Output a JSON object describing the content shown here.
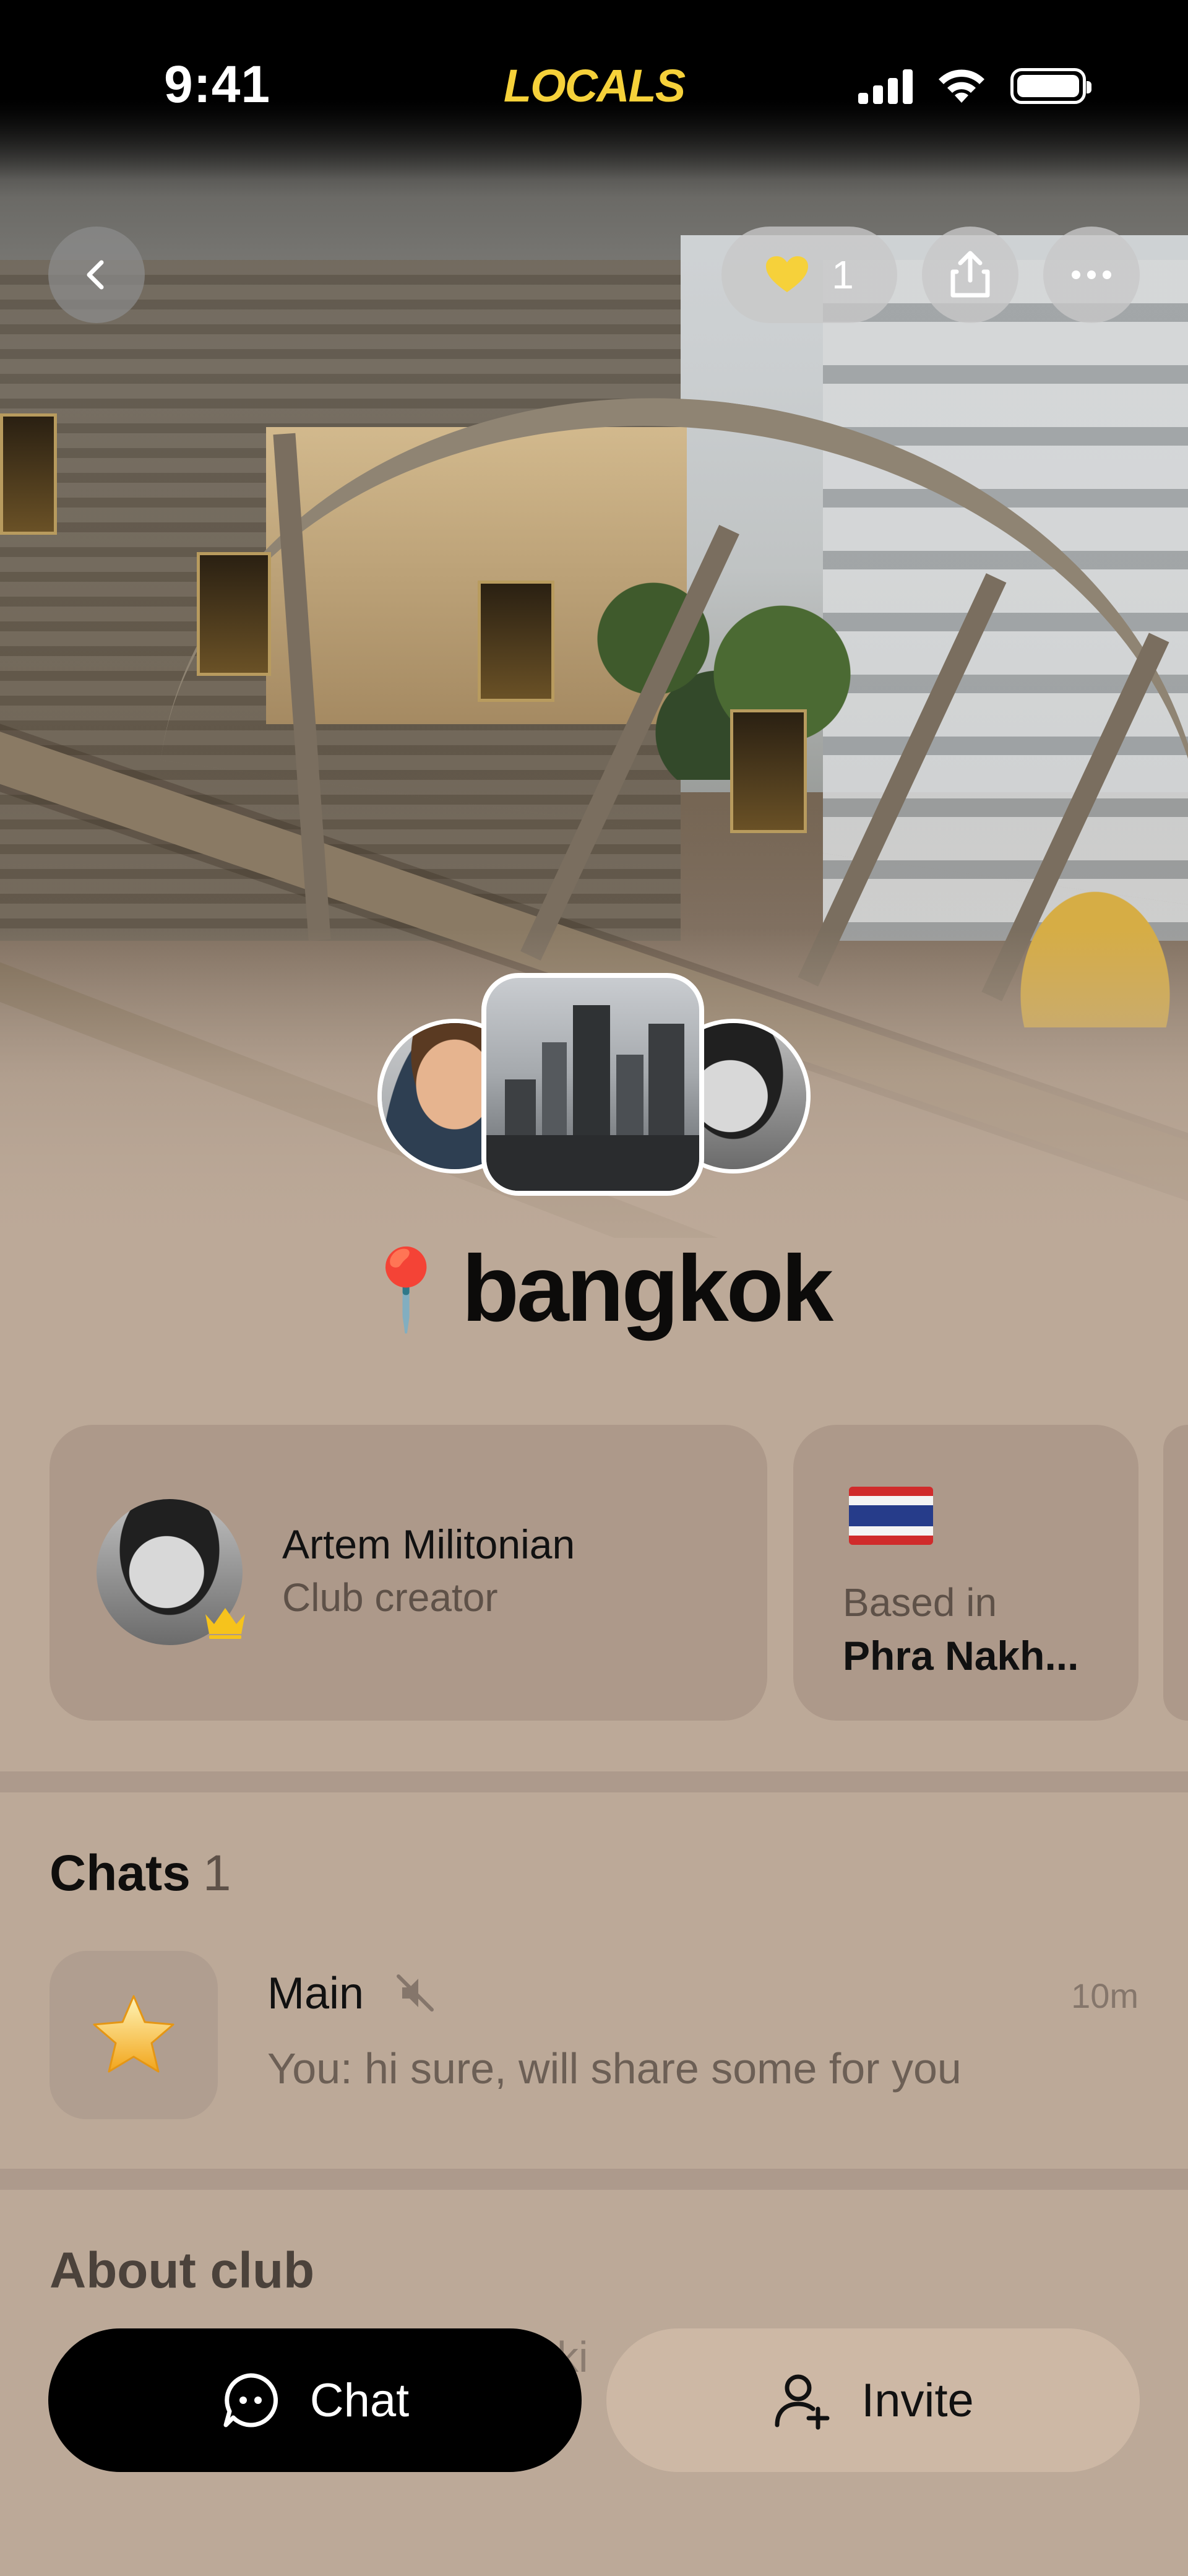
{
  "status_bar": {
    "time": "9:41",
    "brand": "LOCALS",
    "icons": [
      "signal-icon",
      "wifi-icon",
      "battery-icon"
    ]
  },
  "top_controls": {
    "back_icon": "chevron-left-icon",
    "likes": {
      "icon": "heart-icon",
      "count": "1",
      "color": "#f6d13a"
    },
    "share_icon": "share-icon",
    "more_icon": "more-icon"
  },
  "club": {
    "title": "bangkok",
    "pin_emoji": "📍"
  },
  "cards": {
    "creator": {
      "name": "Artem Militonian",
      "role": "Club creator",
      "badge_icon": "crown-icon"
    },
    "location": {
      "label": "Based in",
      "value": "Phra Nakh...",
      "flag_icon": "thailand-flag-icon"
    }
  },
  "chats": {
    "title": "Chats",
    "count": "1",
    "items": [
      {
        "name": "Main",
        "muted": true,
        "time": "10m",
        "preview": "You: hi sure, will share some for you",
        "icon": "star-icon"
      }
    ]
  },
  "about": {
    "title": "About club",
    "text": "ki"
  },
  "bottom_bar": {
    "chat_label": "Chat",
    "invite_label": "Invite"
  },
  "colors": {
    "accent": "#f6d13a",
    "background": "#bca998",
    "card": "#ad998a"
  }
}
